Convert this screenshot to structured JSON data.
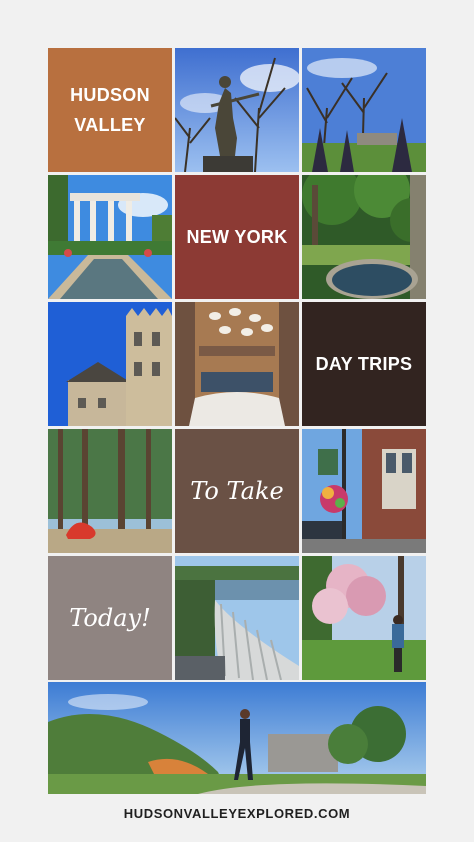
{
  "tiles": {
    "hudson_valley": {
      "line1": "HUDSON",
      "line2": "VALLEY",
      "bg": "#b8703f"
    },
    "new_york": {
      "label": "NEW YORK",
      "bg": "#8c3a34"
    },
    "day_trips": {
      "label": "DAY TRIPS",
      "bg": "#322420"
    },
    "to_take": {
      "label": "To Take",
      "bg": "#6a5145"
    },
    "today": {
      "label": "Today!",
      "bg": "#8f8481"
    }
  },
  "footer": {
    "url": "HUDSONVALLEYEXPLORED.COM"
  }
}
